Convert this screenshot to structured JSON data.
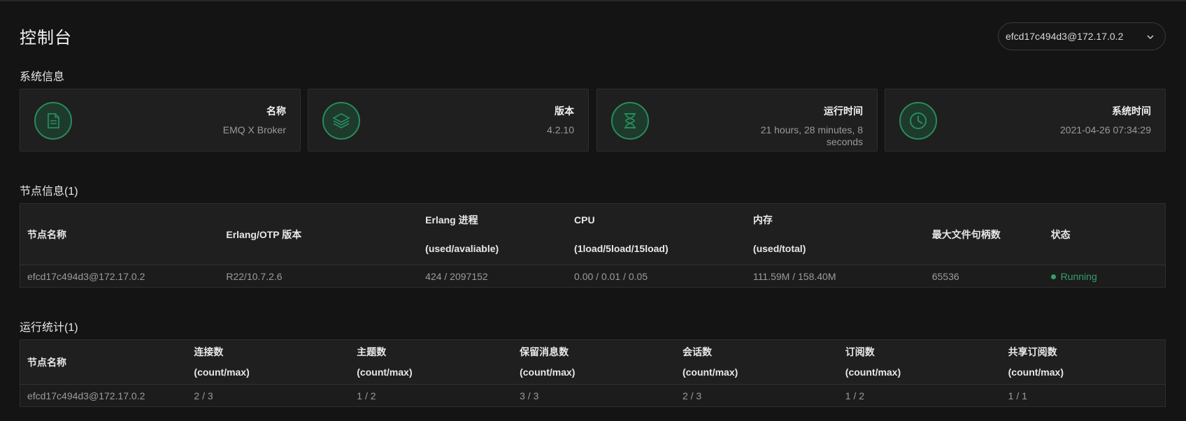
{
  "page": {
    "title": "控制台"
  },
  "node_selector": {
    "value": "efcd17c494d3@172.17.0.2"
  },
  "system_info": {
    "title": "系统信息",
    "cards": [
      {
        "label": "名称",
        "value": "EMQ X Broker",
        "icon": "document-icon"
      },
      {
        "label": "版本",
        "value": "4.2.10",
        "icon": "layers-icon"
      },
      {
        "label": "运行时间",
        "value": "21 hours, 28 minutes, 8 seconds",
        "icon": "hourglass-icon"
      },
      {
        "label": "系统时间",
        "value": "2021-04-26 07:34:29",
        "icon": "clock-icon"
      }
    ]
  },
  "nodes": {
    "title": "节点信息(1)",
    "columns": [
      {
        "main": "节点名称",
        "sub": ""
      },
      {
        "main": "Erlang/OTP 版本",
        "sub": ""
      },
      {
        "main": "Erlang 进程",
        "sub": "(used/avaliable)"
      },
      {
        "main": "CPU",
        "sub": "(1load/5load/15load)"
      },
      {
        "main": "内存",
        "sub": "(used/total)"
      },
      {
        "main": "最大文件句柄数",
        "sub": ""
      },
      {
        "main": "状态",
        "sub": ""
      }
    ],
    "rows": [
      [
        "efcd17c494d3@172.17.0.2",
        "R22/10.7.2.6",
        "424 / 2097152",
        "0.00 / 0.01 / 0.05",
        "111.59M / 158.40M",
        "65536",
        "Running"
      ]
    ],
    "status_color": "#35a06a"
  },
  "stats": {
    "title": "运行统计(1)",
    "columns": [
      {
        "main": "节点名称",
        "sub": ""
      },
      {
        "main": "连接数",
        "sub": "(count/max)"
      },
      {
        "main": "主题数",
        "sub": "(count/max)"
      },
      {
        "main": "保留消息数",
        "sub": "(count/max)"
      },
      {
        "main": "会话数",
        "sub": "(count/max)"
      },
      {
        "main": "订阅数",
        "sub": "(count/max)"
      },
      {
        "main": "共享订阅数",
        "sub": "(count/max)"
      }
    ],
    "rows": [
      [
        "efcd17c494d3@172.17.0.2",
        "2 / 3",
        "1 / 2",
        "3 / 3",
        "2 / 3",
        "1 / 2",
        "1 / 1"
      ]
    ]
  },
  "colors": {
    "accent": "#2a8a5c",
    "background": "#141414",
    "card": "#1f1f1f"
  }
}
